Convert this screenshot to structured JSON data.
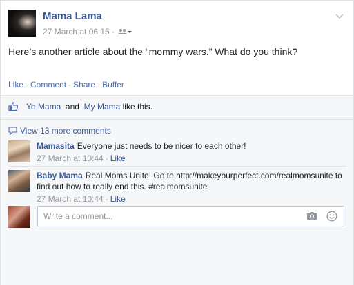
{
  "post": {
    "author": "Mama Lama",
    "timestamp": "27 March at 06:15",
    "audience_icon": "friends-icon",
    "text": "Here’s another article about the “mommy wars.” What do you think?"
  },
  "actions": {
    "like": "Like",
    "comment": "Comment",
    "share": "Share",
    "buffer": "Buffer"
  },
  "likes": {
    "user1": "Yo Mama",
    "and": "and",
    "user2": "My Mama",
    "suffix": "like this."
  },
  "view_more": "View 13 more comments",
  "comments": [
    {
      "name": "Mamasita",
      "text": "Everyone just needs to be nicer to each other!",
      "timestamp": "27 March at 10:44",
      "like": "Like"
    },
    {
      "name": "Baby Mama",
      "text": "Real Moms Unite! Go to http://makeyourperfect.com/realmomsunite to find out how to really end this. #realmomsunite",
      "timestamp": "27 March at 10:44",
      "like": "Like"
    }
  ],
  "composer": {
    "placeholder": "Write a comment..."
  },
  "colors": {
    "link": "#3b5998",
    "meta": "#90949c",
    "footer_bg": "#f6f7f9"
  }
}
